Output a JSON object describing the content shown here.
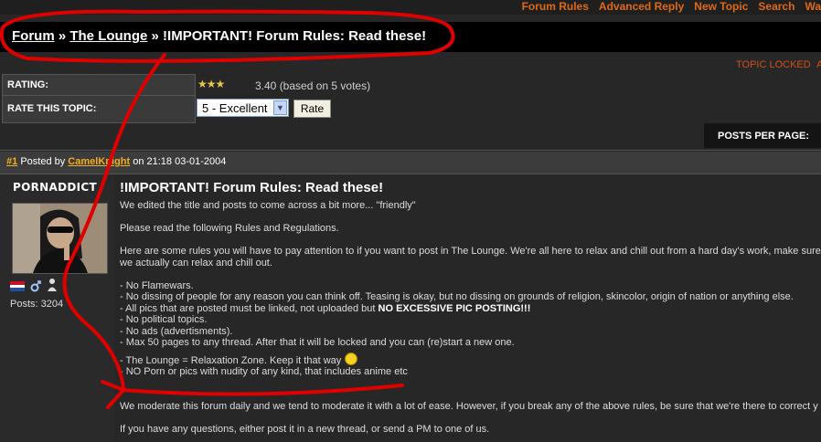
{
  "topnav": {
    "links": [
      "Forum Rules",
      "Advanced Reply",
      "New Topic",
      "Search",
      "Wa"
    ]
  },
  "breadcrumb": {
    "forum": "Forum",
    "sep1": "»",
    "lounge": "The Lounge",
    "sep2": "»",
    "title": "!IMPORTANT! Forum Rules: Read these!"
  },
  "topic_status": {
    "locked": "TOPIC LOCKED",
    "next": "A"
  },
  "rating": {
    "label": "RATING:",
    "stars_display": "★★★",
    "value": 3.4,
    "text": "3.40 (based on 5 votes)",
    "rate_label": "RATE THIS TOPIC:",
    "select_value": "5 - Excellent",
    "rate_button": "Rate"
  },
  "posts_per_page_label": "POSTS PER PAGE:",
  "post": {
    "number": "#1",
    "posted_by": "Posted by",
    "author": "CamelKnight",
    "on": "on 21:18 03-01-2004",
    "username": "PORNADDICT",
    "posts_count": "Posts: 3204",
    "title": "!IMPORTANT! Forum Rules: Read these!",
    "line1": "We edited the title and posts to come across a bit more... \"friendly\"",
    "line2": "Please read the following Rules and Regulations.",
    "line3a": "Here are some rules you will have to pay attention to if you want to post in The Lounge. We're all here to relax and chill out from a hard day's work, make sure y",
    "line3b": "we actually can relax and chill out.",
    "rules": [
      "- No Flamewars.",
      "- No dissing of people for any reason you can think off. Teasing is okay, but no dissing on grounds of religion, skincolor, origin of nation or anything else.",
      "- All pics that are posted must be linked, not uploaded but ",
      "- No political topics.",
      "- No ads (advertisments).",
      "- Max 50 pages to any thread. After that it will be locked and you can (re)start a new one.",
      "- The Lounge = Relaxation Zone. Keep it that way",
      "- NO Porn or pics with nudity of any kind, that includes anime etc"
    ],
    "rule3_bold": "NO EXCESSIVE PIC POSTING!!!",
    "moderate": "We moderate this forum daily and we tend to moderate it with a lot of ease. However, if you break any of the above rules, be sure that we're there to correct y",
    "questions": "If you have any questions, either post it in a new thread, or send a PM to one of us."
  },
  "colors": {
    "background": "#272727",
    "accent_orange": "#e06a10",
    "link_gold": "#f0b020",
    "annotation_red": "#e00000"
  }
}
